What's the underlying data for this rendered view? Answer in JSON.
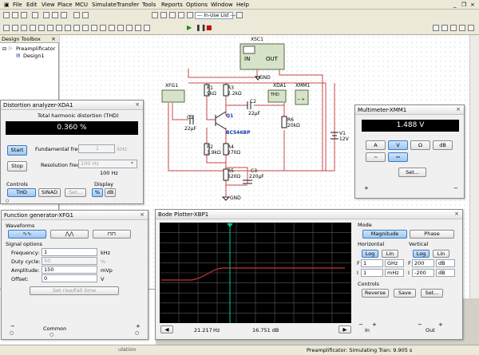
{
  "menu": [
    "File",
    "Edit",
    "View",
    "Place",
    "MCU",
    "Simulate",
    "Transfer",
    "Tools",
    "Reports",
    "Options",
    "Window",
    "Help"
  ],
  "toolbar": {
    "in_use_list": "--- In-Use List ---"
  },
  "design_toolbox": {
    "title": "Design Toolbox",
    "tree": [
      "Preamplificator",
      "Design1"
    ]
  },
  "schematic": {
    "xsc1": "XSC1",
    "in_label": "IN",
    "out_label": "OUT",
    "gnd_top": "GND",
    "gnd_bottom": "GND",
    "xfg1": "XFG1",
    "xda1": "XDA1",
    "xmm1": "XMM1",
    "xmm_buttons": "−  +",
    "thd_label": "THD",
    "r1": "R1",
    "r1_val": "9kΩ",
    "r3": "R3",
    "r3_val": "2.2kΩ",
    "c2": "C2",
    "c2_val": "22µF",
    "c1": "C1",
    "c1_val": "22µF",
    "q1": "Q1",
    "q1_val": "BC546BP",
    "r6": "R6",
    "r6_val": "20kΩ",
    "v1": "V1",
    "v1_val": "12V",
    "r2": "R2",
    "r2_val": "3.9kΩ",
    "r4": "R4",
    "r4_val": "270Ω",
    "r5": "R5",
    "r5_val": "620Ω",
    "c3": "C3",
    "c3_val": "220µF"
  },
  "distortion": {
    "title": "Distortion analyzer-XDA1",
    "thd_label": "Total harmonic distortion (THD)",
    "thd_value": "0.360 %",
    "start": "Start",
    "stop": "Stop",
    "fund_label": "Fundamental freq.",
    "fund_value": "1",
    "fund_unit": "kHz",
    "res_label": "Resolution freq.",
    "res_value": "100 Hz",
    "res_below": "100 Hz",
    "controls_label": "Controls",
    "thd_btn": "THD",
    "sinad_btn": "SINAD",
    "set_btn": "Set...",
    "display_label": "Display",
    "pct_btn": "%",
    "db_btn": "dB"
  },
  "multimeter": {
    "title": "Multimeter-XMM1",
    "value": "1.488 V",
    "a": "A",
    "v": "V",
    "ohm": "Ω",
    "db": "dB",
    "set": "Set...",
    "plus": "+",
    "minus": "−"
  },
  "function_gen": {
    "title": "Function generator-XFG1",
    "waveforms_label": "Waveforms",
    "signal_label": "Signal options",
    "rows": [
      {
        "label": "Frequency:",
        "value": "1",
        "unit": "kHz"
      },
      {
        "label": "Duty cycle:",
        "value": "50",
        "unit": "%"
      },
      {
        "label": "Amplitude:",
        "value": "150",
        "unit": "mVp"
      },
      {
        "label": "Offset:",
        "value": "0",
        "unit": "V"
      }
    ],
    "rise_fall": "Set rise/Fall time",
    "minus": "−",
    "common": "Common",
    "plus": "+"
  },
  "bode": {
    "title": "Bode Plotter-XBP1",
    "mode_label": "Mode",
    "magnitude": "Magnitude",
    "phase": "Phase",
    "horizontal_label": "Horizontal",
    "vertical_label": "Vertical",
    "log": "Log",
    "lin": "Lin",
    "h_f_prefix": "F",
    "h_f_value": "1",
    "h_f_unit": "GHz",
    "h_i_prefix": "I",
    "h_i_value": "1",
    "h_i_unit": "mHz",
    "v_f_prefix": "F",
    "v_f_value": "200",
    "v_f_unit": "dB",
    "v_i_prefix": "I",
    "v_i_value": "-200",
    "v_i_unit": "dB",
    "controls_label": "Controls",
    "reverse": "Reverse",
    "save": "Save",
    "set": "Set...",
    "cursor_x": "21.217",
    "cursor_x_unit": "Hz",
    "cursor_y": "16.751 dB",
    "in_label": "In",
    "out_label": "Out",
    "grid_color": "#5a5a5a",
    "trace_color": "#c83232",
    "cursor_color": "#00c8a0"
  },
  "status": {
    "text": "Preamplificator: Simulating Tran: 9.905 s",
    "left_fragment": "ulation"
  }
}
